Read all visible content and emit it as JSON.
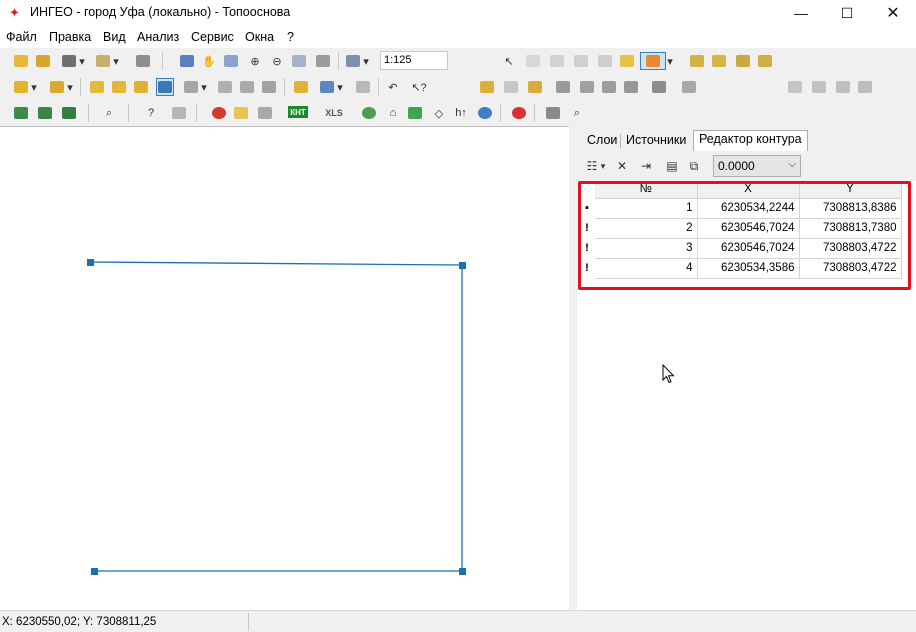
{
  "window": {
    "title": "ИНГЕО - город Уфа (локально) - Топооснова",
    "app_icon": "ingeo-app-icon",
    "minimize": "—",
    "maximize": "☐",
    "close": "✕"
  },
  "menu": [
    {
      "label": "Файл"
    },
    {
      "label": "Правка"
    },
    {
      "label": "Вид"
    },
    {
      "label": "Анализ"
    },
    {
      "label": "Сервис"
    },
    {
      "label": "Окна"
    },
    {
      "label": "?"
    }
  ],
  "toolbar": {
    "scale_value": "1:125",
    "xls_label": "XLS",
    "knt_label": "КНТ"
  },
  "right_panel": {
    "tabs": [
      {
        "label": "Слои"
      },
      {
        "label": "Источники"
      },
      {
        "label": "Редактор контура"
      }
    ],
    "active_tab": "Редактор контура",
    "precision_value": "0.0000",
    "table": {
      "headers": [
        "№",
        "X",
        "Y"
      ],
      "rows": [
        {
          "marker": "▪",
          "n": "1",
          "x": "6230534,2244",
          "y": "7308813,8386"
        },
        {
          "marker": "!",
          "n": "2",
          "x": "6230546,7024",
          "y": "7308813,7380"
        },
        {
          "marker": "!",
          "n": "3",
          "x": "6230546,7024",
          "y": "7308803,4722"
        },
        {
          "marker": "!",
          "n": "4",
          "x": "6230534,3586",
          "y": "7308803,4722"
        }
      ]
    }
  },
  "status": {
    "coords": "X: 6230550,02; Y: 7308811,25"
  },
  "colors": {
    "contour_line": "#1a6fb3",
    "vertex_handle": "#1a6fb3",
    "highlight": "#e3101d",
    "accent": "#cce4f7"
  }
}
